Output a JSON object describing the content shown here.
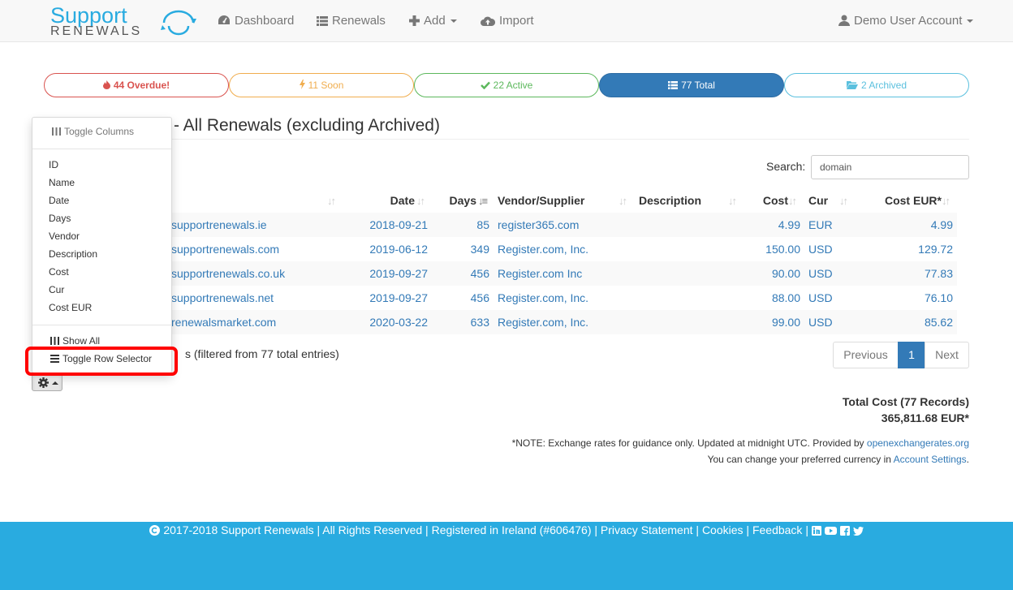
{
  "brand": {
    "line1": "Support",
    "line2": "RENEWALS"
  },
  "nav": {
    "dashboard": "Dashboard",
    "renewals": "Renewals",
    "add": "Add",
    "import": "Import",
    "user": "Demo User Account"
  },
  "pills": {
    "overdue": "44 Overdue!",
    "soon": "11 Soon",
    "active": "22 Active",
    "total": "77 Total",
    "archived": "2 Archived"
  },
  "heading": "- All Renewals (excluding Archived)",
  "show_entries": "s",
  "search": {
    "label": "Search:",
    "value": "domain"
  },
  "columns": [
    "Date",
    "Days",
    "Vendor/Supplier",
    "Description",
    "Cost",
    "Cur",
    "Cost EUR*"
  ],
  "rows": [
    {
      "name": "supportrenewals.ie",
      "date": "2018-09-21",
      "days": "85",
      "vendor": "register365.com",
      "desc": "",
      "cost": "4.99",
      "cur": "EUR",
      "eur": "4.99"
    },
    {
      "name": "supportrenewals.com",
      "date": "2019-06-12",
      "days": "349",
      "vendor": "Register.com, Inc.",
      "desc": "",
      "cost": "150.00",
      "cur": "USD",
      "eur": "129.72"
    },
    {
      "name": "supportrenewals.co.uk",
      "date": "2019-09-27",
      "days": "456",
      "vendor": "Register.com Inc",
      "desc": "",
      "cost": "90.00",
      "cur": "USD",
      "eur": "77.83"
    },
    {
      "name": "supportrenewals.net",
      "date": "2019-09-27",
      "days": "456",
      "vendor": "Register.com, Inc.",
      "desc": "",
      "cost": "88.00",
      "cur": "USD",
      "eur": "76.10"
    },
    {
      "name": "renewalsmarket.com",
      "date": "2020-03-22",
      "days": "633",
      "vendor": "Register.com, Inc.",
      "desc": "",
      "cost": "99.00",
      "cur": "USD",
      "eur": "85.62"
    }
  ],
  "info": "s (filtered from 77 total entries)",
  "pagination": {
    "prev": "Previous",
    "page": "1",
    "next": "Next"
  },
  "totals": {
    "line1": "Total Cost (77 Records)",
    "line2": "365,811.68 EUR*"
  },
  "note": {
    "line1": "*NOTE: Exchange rates for guidance only. Updated at midnight UTC. Provided by",
    "link1": "openexchangerates.org",
    "line2": "You can change your preferred currency in",
    "link2": "Account Settings",
    "end": "."
  },
  "dropdown": {
    "header": "Toggle Columns",
    "items": [
      "ID",
      "Name",
      "Date",
      "Days",
      "Vendor",
      "Description",
      "Cost",
      "Cur",
      "Cost EUR"
    ],
    "show_all": "Show All",
    "toggle_row": "Toggle Row Selector"
  },
  "footer": {
    "copy": "2017-2018 Support Renewals | All Rights Reserved | Registered in Ireland (#606476) |",
    "privacy": "Privacy Statement",
    "cookies": "Cookies",
    "feedback": "Feedback"
  },
  "colors": {
    "primary": "#337ab7",
    "danger": "#d9534f",
    "warning": "#f0ad4e",
    "success": "#5cb85c",
    "info": "#5bc0de",
    "footer": "#29abe0",
    "highlight": "#ff0000"
  }
}
